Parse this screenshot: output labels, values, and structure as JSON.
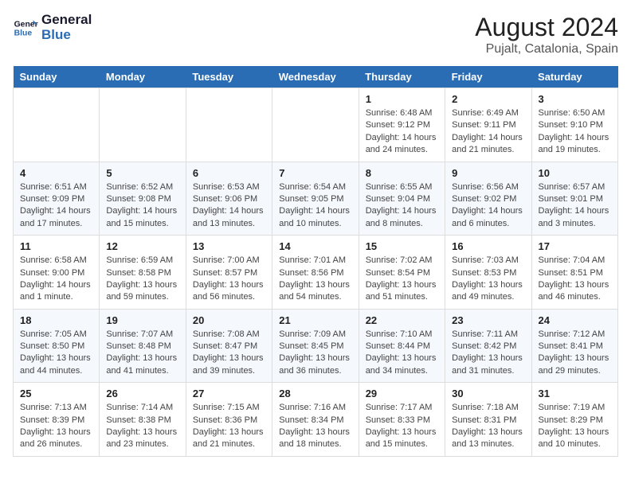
{
  "logo": {
    "line1": "General",
    "line2": "Blue"
  },
  "title": "August 2024",
  "subtitle": "Pujalt, Catalonia, Spain",
  "weekdays": [
    "Sunday",
    "Monday",
    "Tuesday",
    "Wednesday",
    "Thursday",
    "Friday",
    "Saturday"
  ],
  "weeks": [
    [
      {
        "num": "",
        "detail": ""
      },
      {
        "num": "",
        "detail": ""
      },
      {
        "num": "",
        "detail": ""
      },
      {
        "num": "",
        "detail": ""
      },
      {
        "num": "1",
        "detail": "Sunrise: 6:48 AM\nSunset: 9:12 PM\nDaylight: 14 hours and 24 minutes."
      },
      {
        "num": "2",
        "detail": "Sunrise: 6:49 AM\nSunset: 9:11 PM\nDaylight: 14 hours and 21 minutes."
      },
      {
        "num": "3",
        "detail": "Sunrise: 6:50 AM\nSunset: 9:10 PM\nDaylight: 14 hours and 19 minutes."
      }
    ],
    [
      {
        "num": "4",
        "detail": "Sunrise: 6:51 AM\nSunset: 9:09 PM\nDaylight: 14 hours and 17 minutes."
      },
      {
        "num": "5",
        "detail": "Sunrise: 6:52 AM\nSunset: 9:08 PM\nDaylight: 14 hours and 15 minutes."
      },
      {
        "num": "6",
        "detail": "Sunrise: 6:53 AM\nSunset: 9:06 PM\nDaylight: 14 hours and 13 minutes."
      },
      {
        "num": "7",
        "detail": "Sunrise: 6:54 AM\nSunset: 9:05 PM\nDaylight: 14 hours and 10 minutes."
      },
      {
        "num": "8",
        "detail": "Sunrise: 6:55 AM\nSunset: 9:04 PM\nDaylight: 14 hours and 8 minutes."
      },
      {
        "num": "9",
        "detail": "Sunrise: 6:56 AM\nSunset: 9:02 PM\nDaylight: 14 hours and 6 minutes."
      },
      {
        "num": "10",
        "detail": "Sunrise: 6:57 AM\nSunset: 9:01 PM\nDaylight: 14 hours and 3 minutes."
      }
    ],
    [
      {
        "num": "11",
        "detail": "Sunrise: 6:58 AM\nSunset: 9:00 PM\nDaylight: 14 hours and 1 minute."
      },
      {
        "num": "12",
        "detail": "Sunrise: 6:59 AM\nSunset: 8:58 PM\nDaylight: 13 hours and 59 minutes."
      },
      {
        "num": "13",
        "detail": "Sunrise: 7:00 AM\nSunset: 8:57 PM\nDaylight: 13 hours and 56 minutes."
      },
      {
        "num": "14",
        "detail": "Sunrise: 7:01 AM\nSunset: 8:56 PM\nDaylight: 13 hours and 54 minutes."
      },
      {
        "num": "15",
        "detail": "Sunrise: 7:02 AM\nSunset: 8:54 PM\nDaylight: 13 hours and 51 minutes."
      },
      {
        "num": "16",
        "detail": "Sunrise: 7:03 AM\nSunset: 8:53 PM\nDaylight: 13 hours and 49 minutes."
      },
      {
        "num": "17",
        "detail": "Sunrise: 7:04 AM\nSunset: 8:51 PM\nDaylight: 13 hours and 46 minutes."
      }
    ],
    [
      {
        "num": "18",
        "detail": "Sunrise: 7:05 AM\nSunset: 8:50 PM\nDaylight: 13 hours and 44 minutes."
      },
      {
        "num": "19",
        "detail": "Sunrise: 7:07 AM\nSunset: 8:48 PM\nDaylight: 13 hours and 41 minutes."
      },
      {
        "num": "20",
        "detail": "Sunrise: 7:08 AM\nSunset: 8:47 PM\nDaylight: 13 hours and 39 minutes."
      },
      {
        "num": "21",
        "detail": "Sunrise: 7:09 AM\nSunset: 8:45 PM\nDaylight: 13 hours and 36 minutes."
      },
      {
        "num": "22",
        "detail": "Sunrise: 7:10 AM\nSunset: 8:44 PM\nDaylight: 13 hours and 34 minutes."
      },
      {
        "num": "23",
        "detail": "Sunrise: 7:11 AM\nSunset: 8:42 PM\nDaylight: 13 hours and 31 minutes."
      },
      {
        "num": "24",
        "detail": "Sunrise: 7:12 AM\nSunset: 8:41 PM\nDaylight: 13 hours and 29 minutes."
      }
    ],
    [
      {
        "num": "25",
        "detail": "Sunrise: 7:13 AM\nSunset: 8:39 PM\nDaylight: 13 hours and 26 minutes."
      },
      {
        "num": "26",
        "detail": "Sunrise: 7:14 AM\nSunset: 8:38 PM\nDaylight: 13 hours and 23 minutes."
      },
      {
        "num": "27",
        "detail": "Sunrise: 7:15 AM\nSunset: 8:36 PM\nDaylight: 13 hours and 21 minutes."
      },
      {
        "num": "28",
        "detail": "Sunrise: 7:16 AM\nSunset: 8:34 PM\nDaylight: 13 hours and 18 minutes."
      },
      {
        "num": "29",
        "detail": "Sunrise: 7:17 AM\nSunset: 8:33 PM\nDaylight: 13 hours and 15 minutes."
      },
      {
        "num": "30",
        "detail": "Sunrise: 7:18 AM\nSunset: 8:31 PM\nDaylight: 13 hours and 13 minutes."
      },
      {
        "num": "31",
        "detail": "Sunrise: 7:19 AM\nSunset: 8:29 PM\nDaylight: 13 hours and 10 minutes."
      }
    ]
  ]
}
